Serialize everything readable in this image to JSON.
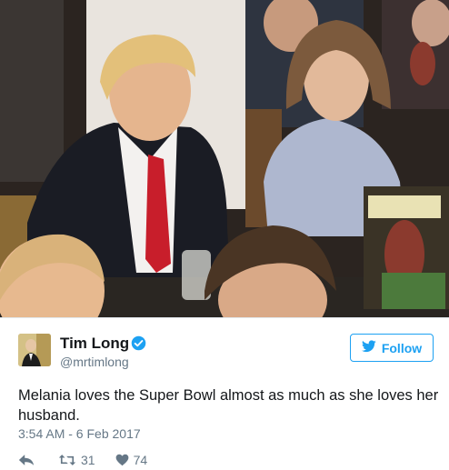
{
  "tweet": {
    "author_name": "Tim Long",
    "author_handle": "@mrtimlong",
    "verified": true,
    "follow_label": "Follow",
    "text": "Melania loves the Super Bowl almost as much as she loves her husband.",
    "timestamp": "3:54 AM - 6 Feb 2017",
    "retweet_count": "31",
    "like_count": "74"
  },
  "icons": {
    "reply": "reply-icon",
    "retweet": "retweet-icon",
    "like": "heart-icon",
    "verified": "verified-badge-icon",
    "follow": "twitter-bird-icon"
  },
  "colors": {
    "brand_blue": "#1da1f2",
    "text_primary": "#14171a",
    "text_secondary": "#657786"
  }
}
